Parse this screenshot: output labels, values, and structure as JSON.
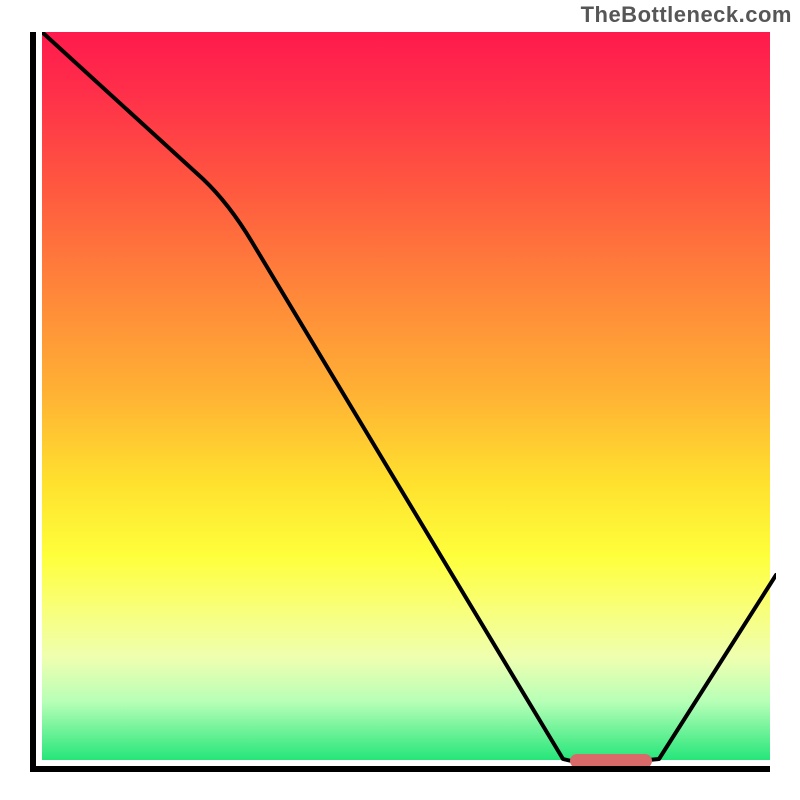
{
  "attribution": "TheBottleneck.com",
  "chart_data": {
    "type": "line",
    "title": "",
    "xlabel": "",
    "ylabel": "",
    "xlim": [
      0,
      100
    ],
    "ylim": [
      0,
      100
    ],
    "x": [
      0,
      22,
      71,
      77,
      84,
      100
    ],
    "y": [
      100,
      80,
      1,
      0,
      1,
      26
    ],
    "optimal_marker": {
      "x_start": 72,
      "x_end": 83,
      "y": 0.6,
      "color": "#d86a6a"
    },
    "background_gradient_stops": [
      {
        "pos": 0,
        "color": "#ff1a4d"
      },
      {
        "pos": 8,
        "color": "#ff2e4a"
      },
      {
        "pos": 22,
        "color": "#ff5a3f"
      },
      {
        "pos": 35,
        "color": "#ff843a"
      },
      {
        "pos": 50,
        "color": "#ffb334"
      },
      {
        "pos": 62,
        "color": "#ffe12e"
      },
      {
        "pos": 72,
        "color": "#feff3b"
      },
      {
        "pos": 79,
        "color": "#f9ff77"
      },
      {
        "pos": 86,
        "color": "#eeffb0"
      },
      {
        "pos": 92,
        "color": "#b7ffb7"
      },
      {
        "pos": 100,
        "color": "#25e67a"
      }
    ]
  }
}
